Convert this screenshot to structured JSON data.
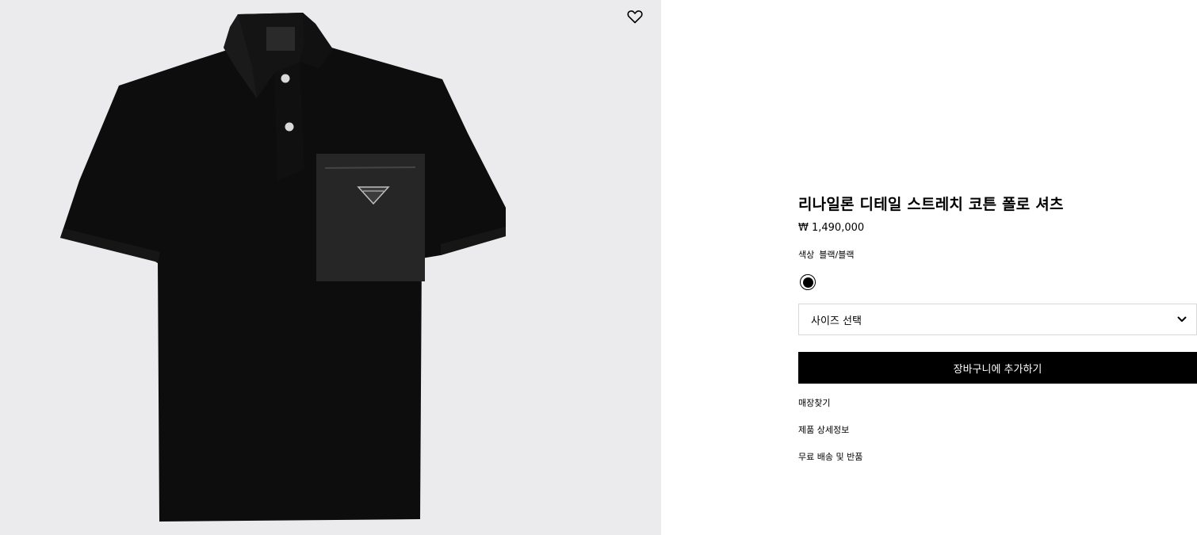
{
  "product": {
    "title": "리나일론 디테일 스트레치 코튼 폴로 셔츠",
    "price": "₩ 1,490,000",
    "color_label": "색상",
    "color_value": "블랙/블랙",
    "swatch_color": "#000000",
    "image_background": "#ebebed"
  },
  "size_select": {
    "label": "사이즈 선택",
    "icon": "chevron-down-icon"
  },
  "actions": {
    "add_to_cart_label": "장바구니에 추가하기"
  },
  "links": [
    {
      "label": "매장찾기"
    },
    {
      "label": "제품 상세정보"
    },
    {
      "label": "무료 배송 및 반품"
    }
  ],
  "icons": {
    "wishlist": "heart-icon"
  }
}
